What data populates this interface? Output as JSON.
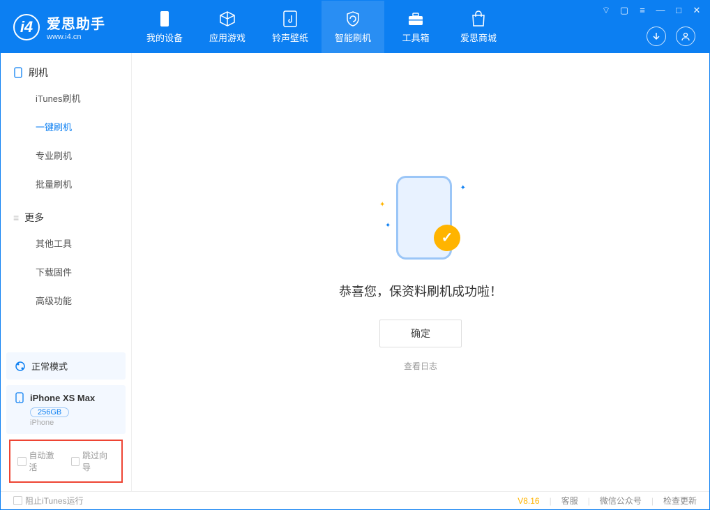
{
  "app": {
    "title": "爱思助手",
    "subtitle": "www.i4.cn"
  },
  "nav": {
    "my_device": "我的设备",
    "apps_games": "应用游戏",
    "ring_wall": "铃声壁纸",
    "smart_flash": "智能刷机",
    "toolbox": "工具箱",
    "store": "爱思商城"
  },
  "sidebar": {
    "flash_header": "刷机",
    "items": {
      "itunes_flash": "iTunes刷机",
      "one_click": "一键刷机",
      "pro_flash": "专业刷机",
      "batch_flash": "批量刷机"
    },
    "more_header": "更多",
    "more_items": {
      "other_tools": "其他工具",
      "download_fw": "下载固件",
      "advanced": "高级功能"
    },
    "mode": "正常模式",
    "device": {
      "name": "iPhone XS Max",
      "capacity": "256GB",
      "type": "iPhone"
    },
    "checkboxes": {
      "auto_activate": "自动激活",
      "skip_guide": "跳过向导"
    }
  },
  "main": {
    "success": "恭喜您，保资料刷机成功啦！",
    "ok": "确定",
    "view_log": "查看日志"
  },
  "footer": {
    "block_itunes": "阻止iTunes运行",
    "version": "V8.16",
    "customer_service": "客服",
    "wechat": "微信公众号",
    "check_update": "检查更新"
  }
}
